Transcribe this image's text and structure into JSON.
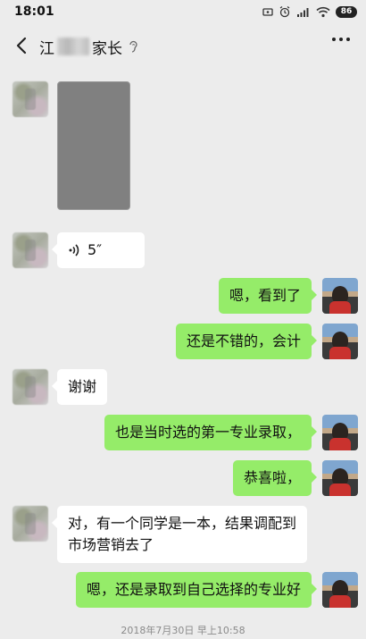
{
  "status_bar": {
    "time": "18:01",
    "battery": "86"
  },
  "nav": {
    "title_prefix": "江",
    "title_suffix": "家长",
    "back_icon": "chevron-left-icon",
    "more_icon": "more-dots-icon",
    "mute_icon": "ear-icon"
  },
  "messages": [
    {
      "side": "in",
      "type": "image"
    },
    {
      "side": "in",
      "type": "voice",
      "duration": "5″"
    },
    {
      "side": "out",
      "type": "text",
      "text": "嗯，看到了"
    },
    {
      "side": "out",
      "type": "text",
      "text": "还是不错的，会计"
    },
    {
      "side": "in",
      "type": "text",
      "text": "谢谢"
    },
    {
      "side": "out",
      "type": "text",
      "text": "也是当时选的第一专业录取，"
    },
    {
      "side": "out",
      "type": "text",
      "text": "恭喜啦，"
    },
    {
      "side": "in",
      "type": "text",
      "text": "对，有一个同学是一本，结果调配到市场营销去了"
    },
    {
      "side": "out",
      "type": "text",
      "text": "嗯，还是录取到自己选择的专业好"
    }
  ],
  "timestamp": "2018年7月30日 早上10:58",
  "colors": {
    "background": "#ececec",
    "out_bubble": "#95ec69",
    "in_bubble": "#ffffff"
  }
}
